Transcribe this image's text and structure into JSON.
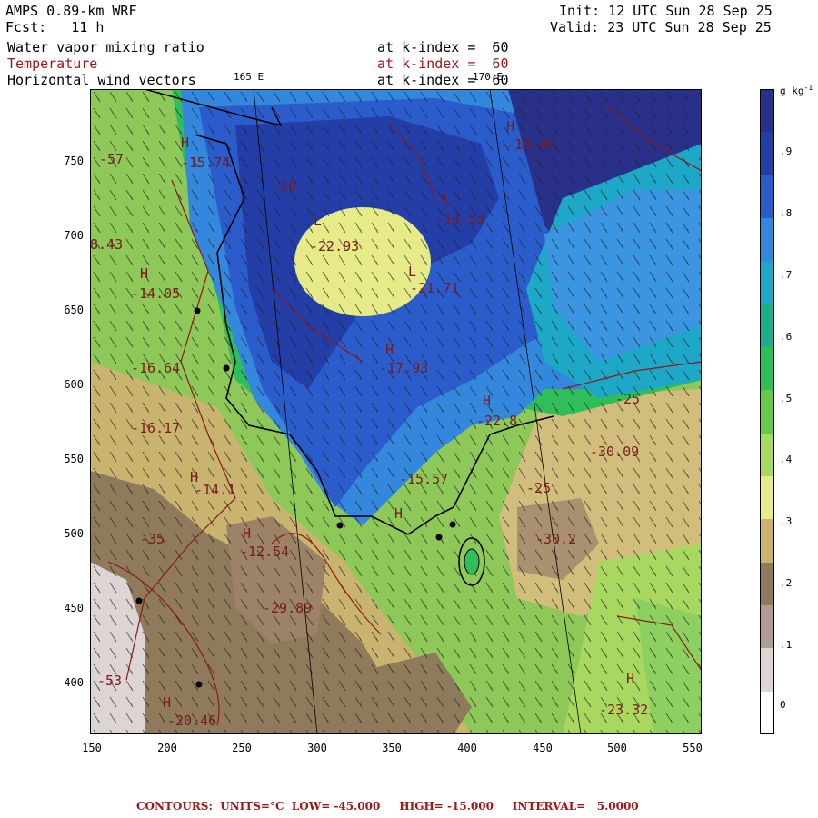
{
  "header": {
    "model": "AMPS 0.89-km WRF",
    "fcst": "Fcst:   11 h",
    "init": "Init: 12 UTC Sun 28 Sep 25",
    "valid": "Valid: 23 UTC Sun 28 Sep 25",
    "field1": "Water vapor mixing ratio",
    "field2": "Temperature",
    "field3": "Horizontal wind vectors",
    "kindex1": "at k-index =  60",
    "kindex2": "at k-index =  60",
    "kindex3": "at k-index =  60",
    "lon1": "165 E",
    "lon2": "170 E"
  },
  "axes": {
    "y_ticks": [
      "750",
      "700",
      "650",
      "600",
      "550",
      "500",
      "450",
      "400"
    ],
    "x_ticks": [
      "150",
      "200",
      "250",
      "300",
      "350",
      "400",
      "450",
      "500",
      "550"
    ]
  },
  "colorbar": {
    "unit": "g kg",
    "unit_sup": "-1",
    "labels": [
      ".9",
      ".8",
      ".7",
      ".6",
      ".5",
      ".4",
      ".3",
      ".2",
      ".1",
      "0"
    ],
    "colors": [
      "#28308a",
      "#243ea8",
      "#2a5ccc",
      "#3388dd",
      "#1ea8c8",
      "#1fae8a",
      "#2fbe5a",
      "#67c84a",
      "#a9d860",
      "#e6eb88",
      "#c8b46e",
      "#8f7a5c",
      "#b09a94",
      "#ddd4d4",
      "#ffffff"
    ]
  },
  "map_labels": {
    "t1": "-15.74",
    "t2": "8.43",
    "t3": "-14.05",
    "t4": "-16.64",
    "t5": "-16.17",
    "t6": "-22.93",
    "t7": "-21.71",
    "t8": "-19.53",
    "t9": "-19.43",
    "t10": "-17.93",
    "t11": "-22.8",
    "t12": "-15.57",
    "t13": "-30.09",
    "t14": "-30.2",
    "t15": "-29.89",
    "t16": "-14.1",
    "t17": "-12.54",
    "t18": "-20.46",
    "t19": "-23.32",
    "t20": "-25",
    "t21": "-20",
    "t22": "-25",
    "t23": "-35",
    "t24": "-53",
    "t25": "-57"
  },
  "footer": "CONTOURS:  UNITS=°C  LOW= -45.000     HIGH= -15.000     INTERVAL=   5.0000"
}
